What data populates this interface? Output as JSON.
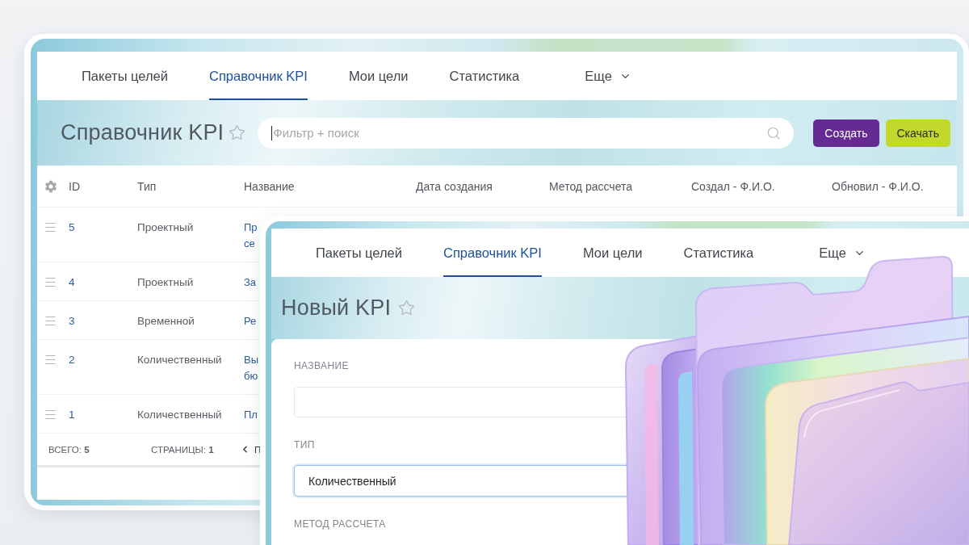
{
  "back_window": {
    "nav": [
      {
        "label": "Пакеты целей",
        "kind": "tab",
        "selected": false
      },
      {
        "label": "Справочник KPI",
        "kind": "tab",
        "selected": true
      },
      {
        "label": "Мои цели",
        "kind": "tab",
        "selected": false
      },
      {
        "label": "Статистика",
        "kind": "tab",
        "selected": false
      },
      {
        "label": "Еще",
        "kind": "menu",
        "selected": false
      }
    ],
    "header": {
      "title": "Справочник KPI",
      "starred": false
    },
    "search": {
      "placeholder": "Фильтр + поиск",
      "focused": true
    },
    "buttons": [
      {
        "label": "Создать",
        "kind": "primary"
      },
      {
        "label": "Скачать",
        "kind": "secondary"
      }
    ],
    "table": {
      "columns": [
        "ID",
        "Тип",
        "Название",
        "Дата создания",
        "Метод рассчета",
        "Создал - Ф.И.О.",
        "Обновил - Ф.И.О."
      ],
      "rows": [
        {
          "id": "5",
          "type": "Проектный",
          "name": "Пр\nсе"
        },
        {
          "id": "4",
          "type": "Проектный",
          "name": "За"
        },
        {
          "id": "3",
          "type": "Временной",
          "name": "Ре"
        },
        {
          "id": "2",
          "type": "Количественный",
          "name": "Вы\nбю"
        },
        {
          "id": "1",
          "type": "Количественный",
          "name": "Пл"
        }
      ]
    },
    "footer": {
      "total": "ВСЕГО: **5**",
      "pages": "СТРАНИЦЫ: **1**",
      "previous": "П"
    }
  },
  "front_window": {
    "nav": [
      {
        "label": "Пакеты целей",
        "kind": "tab",
        "selected": false
      },
      {
        "label": "Справочник KPI",
        "kind": "tab",
        "selected": true
      },
      {
        "label": "Мои цели",
        "kind": "tab",
        "selected": false
      },
      {
        "label": "Статистика",
        "kind": "tab",
        "selected": false
      },
      {
        "label": "Еще",
        "kind": "menu",
        "selected": false
      }
    ],
    "header": {
      "title": "Новый KPI",
      "starred": false
    },
    "form": {
      "fields": [
        {
          "label": "НАЗВАНИЕ",
          "control": {
            "kind": "text",
            "focused": false
          }
        },
        {
          "label": "ТИП",
          "control": {
            "kind": "select",
            "value": "Количественный",
            "focused": true
          }
        },
        {
          "label": "МЕТОД РАССЧЕТА"
        }
      ]
    }
  }
}
